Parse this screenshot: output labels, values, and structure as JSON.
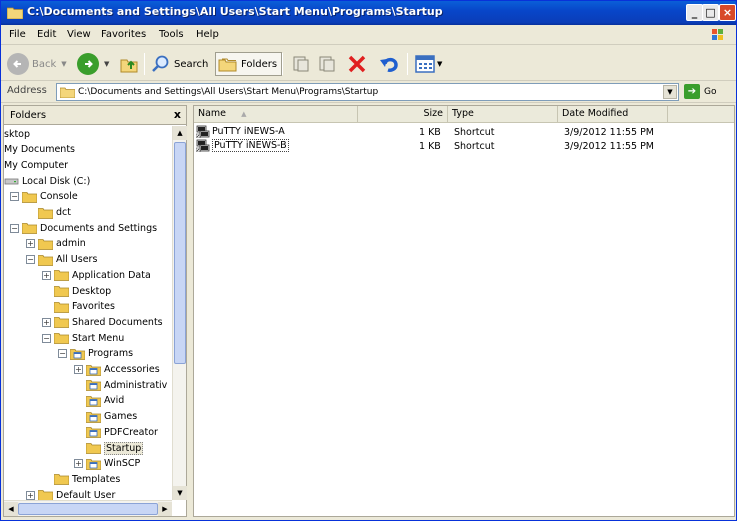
{
  "window": {
    "title": "C:\\Documents and Settings\\All Users\\Start Menu\\Programs\\Startup",
    "minimize": "_",
    "maximize": "□",
    "close": "×"
  },
  "menu": [
    "File",
    "Edit",
    "View",
    "Favorites",
    "Tools",
    "Help"
  ],
  "toolbar": {
    "back_label": "Back",
    "search_label": "Search",
    "folders_label": "Folders"
  },
  "address": {
    "label": "Address",
    "value": "C:\\Documents and Settings\\All Users\\Start Menu\\Programs\\Startup",
    "go_label": "Go"
  },
  "folders_pane": {
    "title": "Folders",
    "close": "x",
    "tree": [
      {
        "label": "sktop",
        "icon": "none"
      },
      {
        "label": "My Documents",
        "icon": "none"
      },
      {
        "label": "My Computer",
        "icon": "none"
      },
      {
        "label": "Local Disk (C:)",
        "icon": "drive-icon"
      },
      {
        "label": "Console",
        "icon": "folder-icon",
        "expander": "−"
      },
      {
        "label": "dct",
        "icon": "folder-icon"
      },
      {
        "label": "Documents and Settings",
        "icon": "folder-icon",
        "expander": "−"
      },
      {
        "label": "admin",
        "icon": "folder-icon",
        "expander": "+"
      },
      {
        "label": "All Users",
        "icon": "folder-icon",
        "expander": "−"
      },
      {
        "label": "Application Data",
        "icon": "folder-icon",
        "expander": "+"
      },
      {
        "label": "Desktop",
        "icon": "folder-icon"
      },
      {
        "label": "Favorites",
        "icon": "folder-icon"
      },
      {
        "label": "Shared Documents",
        "icon": "folder-icon",
        "expander": "+"
      },
      {
        "label": "Start Menu",
        "icon": "folder-icon",
        "expander": "−"
      },
      {
        "label": "Programs",
        "icon": "program-folder-icon",
        "expander": "−"
      },
      {
        "label": "Accessories",
        "icon": "program-folder-icon",
        "expander": "+"
      },
      {
        "label": "Administrativ",
        "icon": "program-folder-icon"
      },
      {
        "label": "Avid",
        "icon": "program-folder-icon"
      },
      {
        "label": "Games",
        "icon": "program-folder-icon"
      },
      {
        "label": "PDFCreator",
        "icon": "program-folder-icon"
      },
      {
        "label": "Startup",
        "icon": "folder-icon",
        "selected": true
      },
      {
        "label": "WinSCP",
        "icon": "program-folder-icon",
        "expander": "+"
      },
      {
        "label": "Templates",
        "icon": "folder-icon"
      },
      {
        "label": "Default User",
        "icon": "folder-icon",
        "expander": "+"
      }
    ]
  },
  "file_list": {
    "columns": [
      "Name",
      "Size",
      "Type",
      "Date Modified"
    ],
    "sort_indicator": "▲",
    "rows": [
      {
        "name": "PuTTY iNEWS-A",
        "size": "1 KB",
        "type": "Shortcut",
        "modified": "3/9/2012 11:55 PM",
        "focused": false
      },
      {
        "name": "PuTTY iNEWS-B",
        "size": "1 KB",
        "type": "Shortcut",
        "modified": "3/9/2012 11:55 PM",
        "focused": true
      }
    ]
  },
  "colors": {
    "titlebar": "#0a46c9",
    "window_bg": "#ece9d8",
    "folder": "#f0c850"
  }
}
